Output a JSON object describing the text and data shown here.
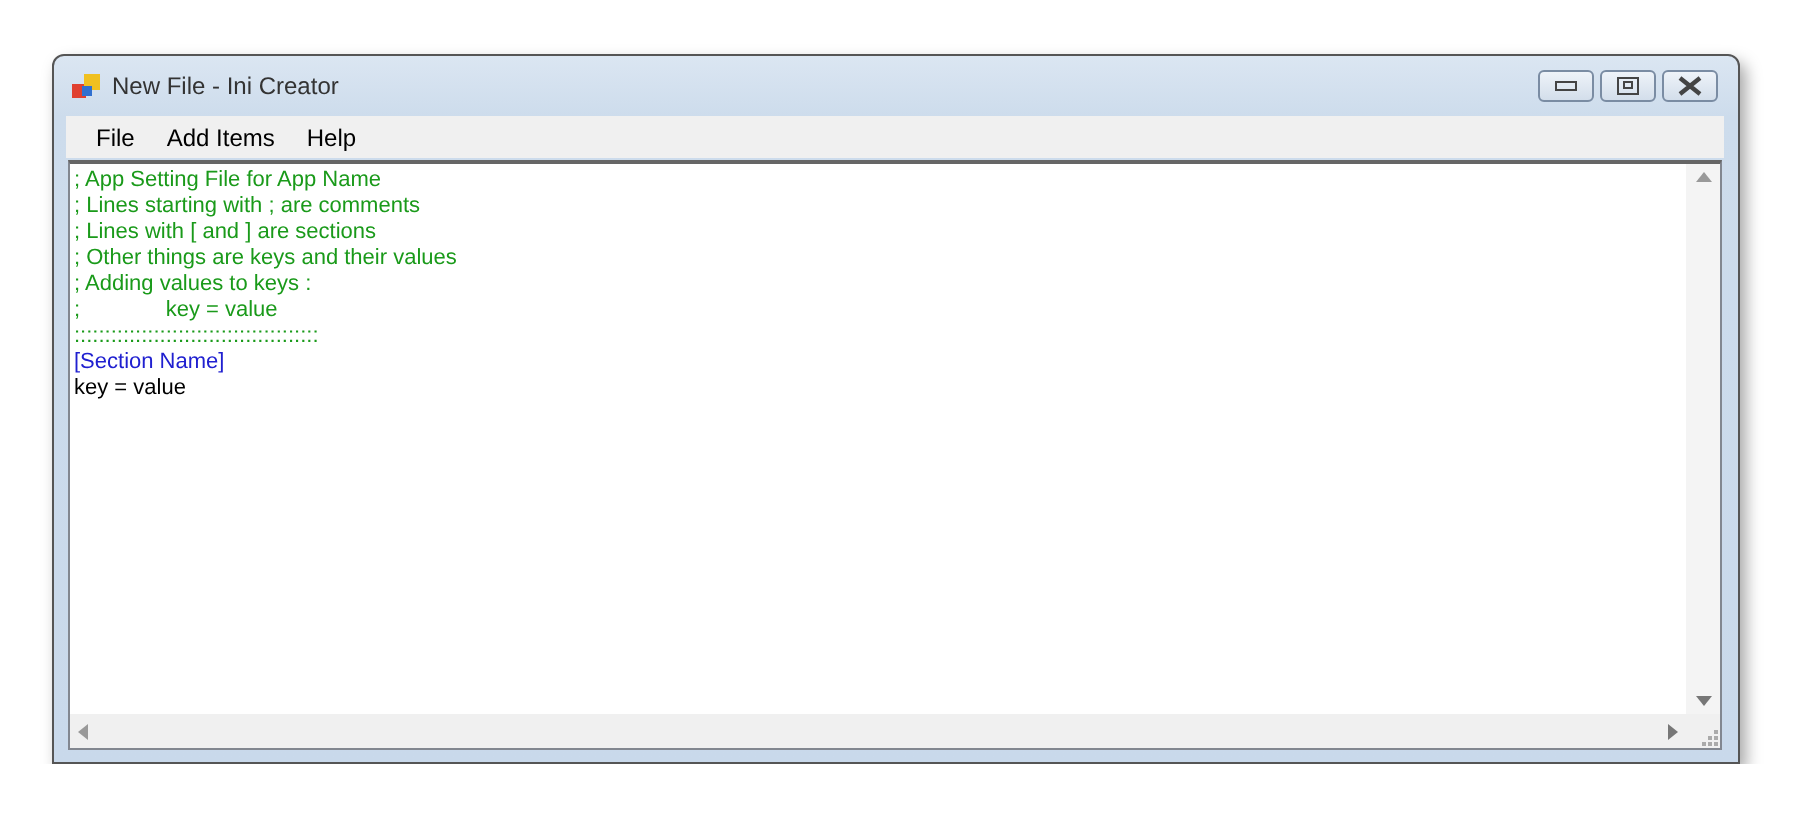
{
  "window": {
    "title": "New File - Ini Creator"
  },
  "menu": [
    "File",
    "Add Items",
    "Help"
  ],
  "editor": {
    "lines": [
      {
        "kind": "comment",
        "text": "; App Setting File for App Name"
      },
      {
        "kind": "comment",
        "text": "; Lines starting with ; are comments"
      },
      {
        "kind": "comment",
        "text": "; Lines with [ and ] are sections"
      },
      {
        "kind": "comment",
        "text": "; Other things are keys and their values"
      },
      {
        "kind": "comment",
        "text": "; Adding values to keys :"
      },
      {
        "kind": "comment",
        "text": ";              key = value"
      },
      {
        "kind": "comment",
        "text": "::::::::::::::::::::::::::::::::::::::::"
      },
      {
        "kind": "section",
        "text": "[Section Name]"
      },
      {
        "kind": "key",
        "text": "key = value"
      }
    ]
  }
}
